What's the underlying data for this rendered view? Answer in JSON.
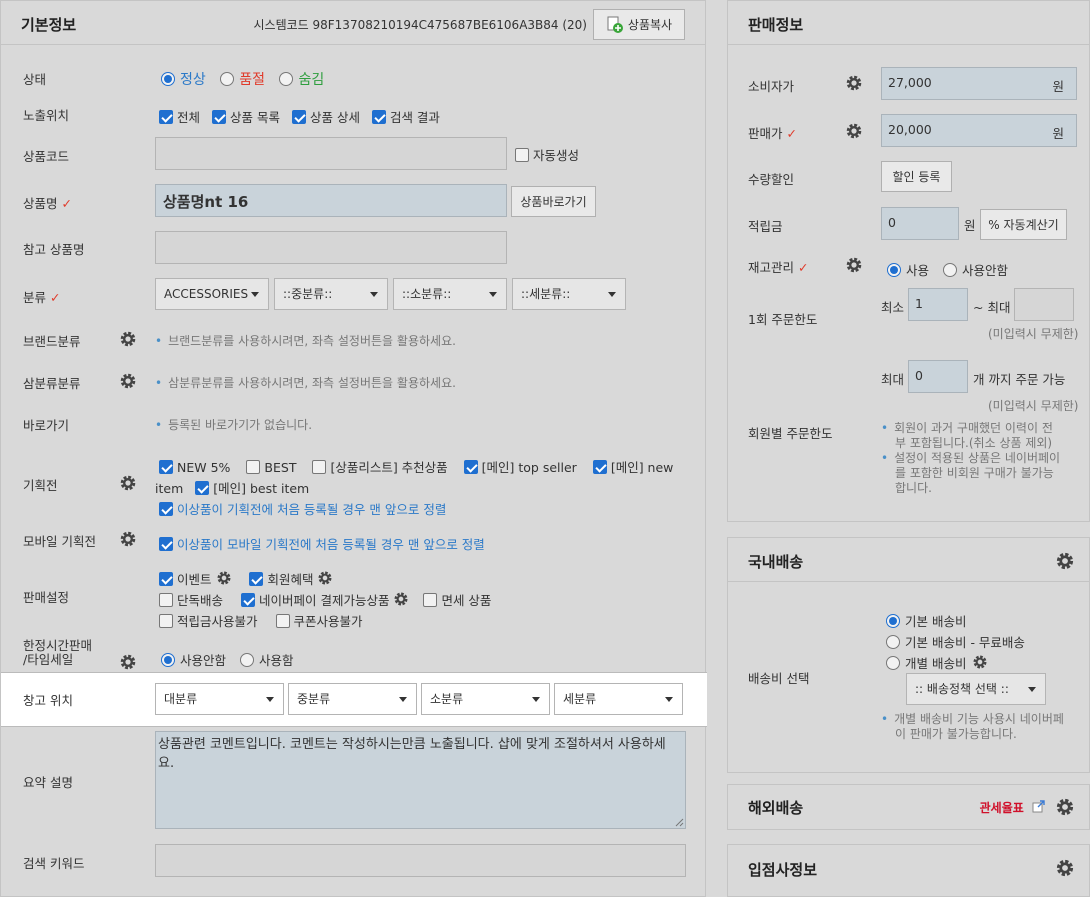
{
  "basic": {
    "title": "기본정보",
    "system_code": "시스템코드 98F13708210194C475687BE6106A3B84 (20)",
    "copy_button": "상품복사",
    "status": {
      "label": "상태",
      "options": [
        "정상",
        "품절",
        "숨김"
      ],
      "selected": "정상"
    },
    "exposure": {
      "label": "노출위치",
      "options": [
        "전체",
        "상품 목록",
        "상품 상세",
        "검색 결과"
      ]
    },
    "product_code": {
      "label": "상품코드",
      "auto_label": "자동생성"
    },
    "product_name": {
      "label": "상품명",
      "value": "상품명nt 16",
      "shortcut_button": "상품바로가기"
    },
    "reference_name": {
      "label": "참고 상품명"
    },
    "category": {
      "label": "분류",
      "selects": [
        "ACCESSORIES",
        "::중분류::",
        "::소분류::",
        "::세분류::"
      ]
    },
    "brand": {
      "label": "브랜드분류",
      "help": "브랜드분류를 사용하시려면, 좌측 설정버튼을 활용하세요."
    },
    "sambun": {
      "label": "삼분류분류",
      "help": "삼분류분류를 사용하시려면, 좌측 설정버튼을 활용하세요."
    },
    "shortcut": {
      "label": "바로가기",
      "help": "등록된 바로가기가 없습니다."
    },
    "promotion": {
      "label": "기획전",
      "items": [
        "NEW 5%",
        "BEST",
        "[상품리스트] 추천상품",
        "[메인] top seller",
        "[메인] new",
        "item",
        "[메인] best item"
      ],
      "note": "이상품이 기획전에 처음 등록될 경우 맨 앞으로 정렬"
    },
    "mobile_promotion": {
      "label": "모바일 기획전",
      "note": "이상품이 모바일 기획전에 처음 등록될 경우 맨 앞으로 정렬"
    },
    "sales_settings": {
      "label": "판매설정",
      "items": [
        "이벤트",
        "회원혜택",
        "단독배송",
        "네이버페이 결제가능상품",
        "면세 상품",
        "적립금사용불가",
        "쿠폰사용불가"
      ]
    },
    "time_sale": {
      "label_line1": "한정시간판매",
      "label_line2": "/타임세일",
      "options": [
        "사용안함",
        "사용함"
      ]
    },
    "warehouse": {
      "label": "창고 위치",
      "selects": [
        "대분류",
        "중분류",
        "소분류",
        "세분류"
      ]
    },
    "summary": {
      "label": "요약 설명",
      "value": "상품관련 코멘트입니다. 코멘트는 작성하시는만큼 노출됩니다. 샵에 맞게 조절하셔서 사용하세요."
    },
    "keyword": {
      "label": "검색 키워드"
    }
  },
  "sales": {
    "title": "판매정보",
    "consumer_price": {
      "label": "소비자가",
      "value": "27,000",
      "unit": "원"
    },
    "sale_price": {
      "label": "판매가",
      "value": "20,000",
      "unit": "원"
    },
    "quantity_discount": {
      "label": "수량할인",
      "button": "할인 등록"
    },
    "reserve": {
      "label": "적립금",
      "value": "0",
      "unit": "원",
      "button": "% 자동계산기"
    },
    "stock": {
      "label": "재고관리",
      "options": [
        "사용",
        "사용안함"
      ]
    },
    "order_limit": {
      "label": "1회 주문한도",
      "min_label": "최소",
      "min_value": "1",
      "max_label": "~ 최대",
      "note": "(미입력시 무제한)"
    },
    "max_limit": {
      "label": "최대",
      "value": "0",
      "suffix": "개 까지 주문 가능",
      "note": "(미입력시 무제한)"
    },
    "member_limit": {
      "label": "회원별 주문한도",
      "help1a": "회원이 과거 구매했던 이력이 전",
      "help1b": "부 포함됩니다.(취소 상품 제외)",
      "help2a": "설정이 적용된 상품은 네이버페이",
      "help2b": "를 포함한 비회원 구매가 불가능",
      "help2c": "합니다."
    }
  },
  "domestic": {
    "title": "국내배송",
    "label": "배송비 선택",
    "options": [
      "기본 배송비",
      "기본 배송비 - 무료배송",
      "개별 배송비"
    ],
    "policy_select": ":: 배송정책 선택 ::",
    "help_a": "개별 배송비 기능 사용시 네이버페",
    "help_b": "이 판매가 불가능합니다."
  },
  "overseas": {
    "title": "해외배송",
    "link": "관세율표"
  },
  "vendor": {
    "title": "입점사정보"
  }
}
